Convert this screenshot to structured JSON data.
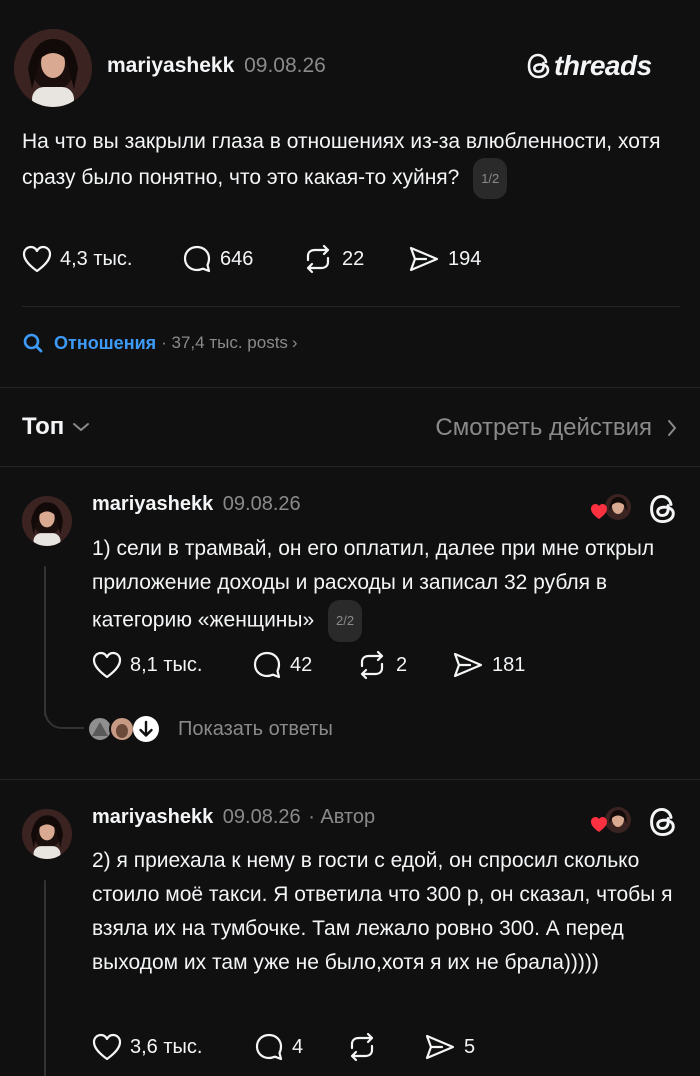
{
  "header_post": {
    "username": "mariyashekk",
    "date": "09.08.26",
    "brand": "threads",
    "text": "На что вы закрыли глаза в отношениях из-за влюбленности, хотя сразу было понятно, что это какая-то хуйня?",
    "pager": "1/2",
    "likes": "4,3 тыс.",
    "replies": "646",
    "reposts": "22",
    "shares": "194"
  },
  "topic": {
    "name": "Отношения",
    "meta": "· 37,4 тыс. posts",
    "chevron": "›"
  },
  "sort": {
    "label": "Топ",
    "activity": "Смотреть действия"
  },
  "replies": [
    {
      "username": "mariyashekk",
      "date": "09.08.26",
      "author_tag": "",
      "text": "1) сели в трамвай, он его оплатил, далее при мне открыл приложение доходы и расходы и записал 32 рубля в категорию «женщины»",
      "pager": "2/2",
      "likes": "8,1 тыс.",
      "replies": "42",
      "reposts": "2",
      "shares": "181",
      "show_replies": "Показать ответы"
    },
    {
      "username": "mariyashekk",
      "date": "09.08.26",
      "author_tag": "· Автор",
      "text": "2) я приехала к нему в гости с едой, он спросил сколько стоило моё такси. Я ответила что 300 р, он сказал, чтобы я взяла их на тумбочке. Там лежало ровно 300. А перед выходом их там уже не было,хотя я их не брала)))))",
      "likes": "3,6 тыс.",
      "replies": "4",
      "reposts": "",
      "shares": "5"
    }
  ],
  "colors": {
    "background": "#101010",
    "accent_blue": "#3d9af6",
    "like_red": "#ff3040",
    "muted": "#8a8a8a"
  }
}
